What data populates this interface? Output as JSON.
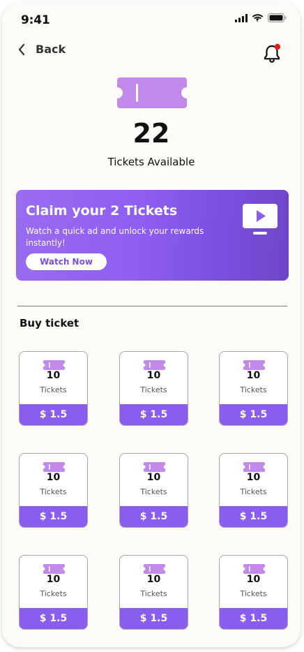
{
  "status_bar": {
    "time": "9:41"
  },
  "nav": {
    "back_label": "Back"
  },
  "hero": {
    "count": "22",
    "subtitle": "Tickets Available"
  },
  "promo": {
    "title": "Claim your 2 Tickets",
    "description": "Watch a quick ad and unlock your rewards instantly!",
    "button_label": "Watch Now",
    "icon": "tv-play-icon"
  },
  "buy_section": {
    "title": "Buy ticket",
    "packages": [
      {
        "count": "10",
        "unit": "Tickets",
        "price": "$ 1.5"
      },
      {
        "count": "10",
        "unit": "Tickets",
        "price": "$ 1.5"
      },
      {
        "count": "10",
        "unit": "Tickets",
        "price": "$ 1.5"
      },
      {
        "count": "10",
        "unit": "Tickets",
        "price": "$ 1.5"
      },
      {
        "count": "10",
        "unit": "Tickets",
        "price": "$ 1.5"
      },
      {
        "count": "10",
        "unit": "Tickets",
        "price": "$ 1.5"
      },
      {
        "count": "10",
        "unit": "Tickets",
        "price": "$ 1.5"
      },
      {
        "count": "10",
        "unit": "Tickets",
        "price": "$ 1.5"
      },
      {
        "count": "10",
        "unit": "Tickets",
        "price": "$ 1.5"
      }
    ]
  },
  "colors": {
    "accent": "#8a5df0",
    "ticket": "#c18aea",
    "notification_dot": "#e0201b",
    "background": "#fcfbf7"
  }
}
